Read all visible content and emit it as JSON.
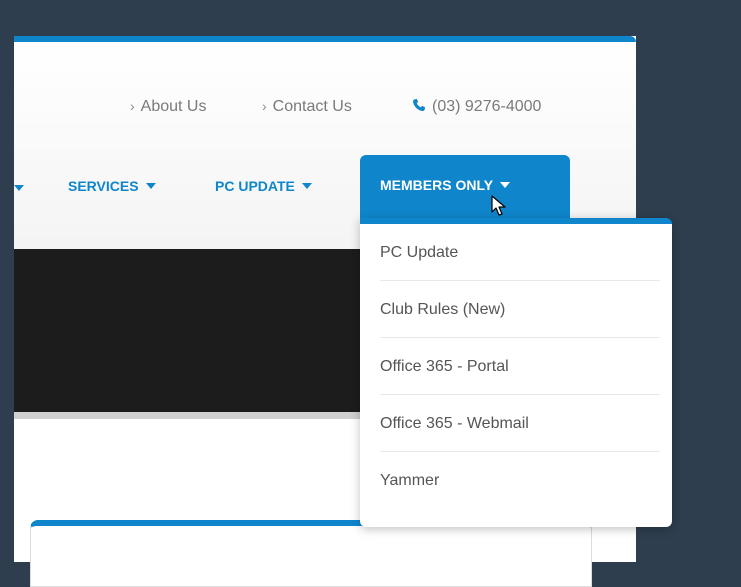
{
  "top_links": {
    "about": "About Us",
    "contact": "Contact Us",
    "phone": "(03) 9276-4000",
    "chevron": "›"
  },
  "nav": {
    "services": "SERVICES",
    "pc_update": "PC UPDATE",
    "members_only": "MEMBERS ONLY"
  },
  "dropdown": {
    "items": [
      "PC Update",
      "Club Rules (New)",
      "Office 365 - Portal",
      "Office 365 - Webmail",
      "Yammer"
    ]
  },
  "colors": {
    "accent": "#0f86cc",
    "background": "#2e3e4e",
    "hero": "#1c1c1c",
    "link_text": "#7a7a7a"
  },
  "icons": [
    "chevron-right-icon",
    "phone-icon",
    "caret-down-icon",
    "mouse-cursor-icon"
  ]
}
